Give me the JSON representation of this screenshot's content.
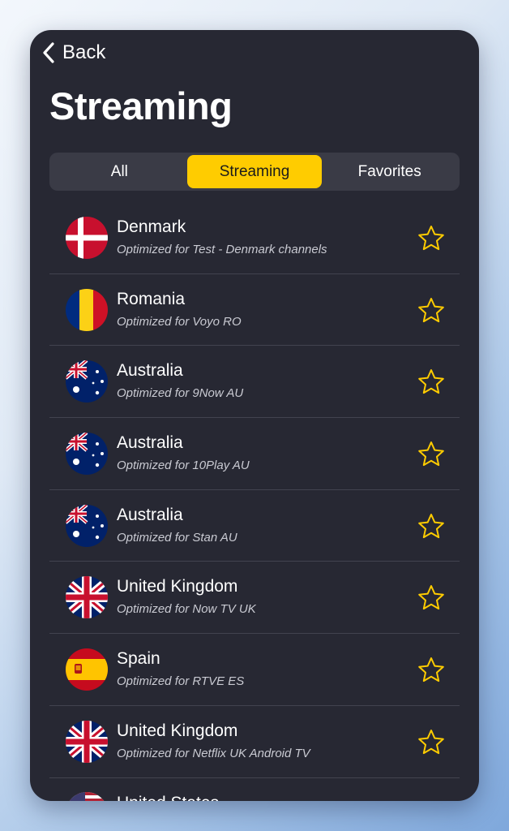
{
  "nav": {
    "back_label": "Back"
  },
  "page": {
    "title": "Streaming"
  },
  "segments": [
    {
      "label": "All",
      "active": false
    },
    {
      "label": "Streaming",
      "active": true
    },
    {
      "label": "Favorites",
      "active": false
    }
  ],
  "colors": {
    "accent": "#ffcc00",
    "panel": "#272833",
    "star": "#ffcc00"
  },
  "servers": [
    {
      "country": "Denmark",
      "subtitle": "Optimized for Test - Denmark channels",
      "flag": "denmark-flag-icon"
    },
    {
      "country": "Romania",
      "subtitle": "Optimized for Voyo RO",
      "flag": "romania-flag-icon"
    },
    {
      "country": "Australia",
      "subtitle": "Optimized for 9Now AU",
      "flag": "australia-flag-icon"
    },
    {
      "country": "Australia",
      "subtitle": "Optimized for 10Play AU",
      "flag": "australia-flag-icon"
    },
    {
      "country": "Australia",
      "subtitle": "Optimized for Stan AU",
      "flag": "australia-flag-icon"
    },
    {
      "country": "United Kingdom",
      "subtitle": "Optimized for Now TV UK",
      "flag": "uk-flag-icon"
    },
    {
      "country": "Spain",
      "subtitle": "Optimized for RTVE ES",
      "flag": "spain-flag-icon"
    },
    {
      "country": "United Kingdom",
      "subtitle": "Optimized for Netflix UK Android TV",
      "flag": "uk-flag-icon"
    },
    {
      "country": "United States",
      "subtitle": "",
      "flag": "us-flag-icon"
    }
  ]
}
